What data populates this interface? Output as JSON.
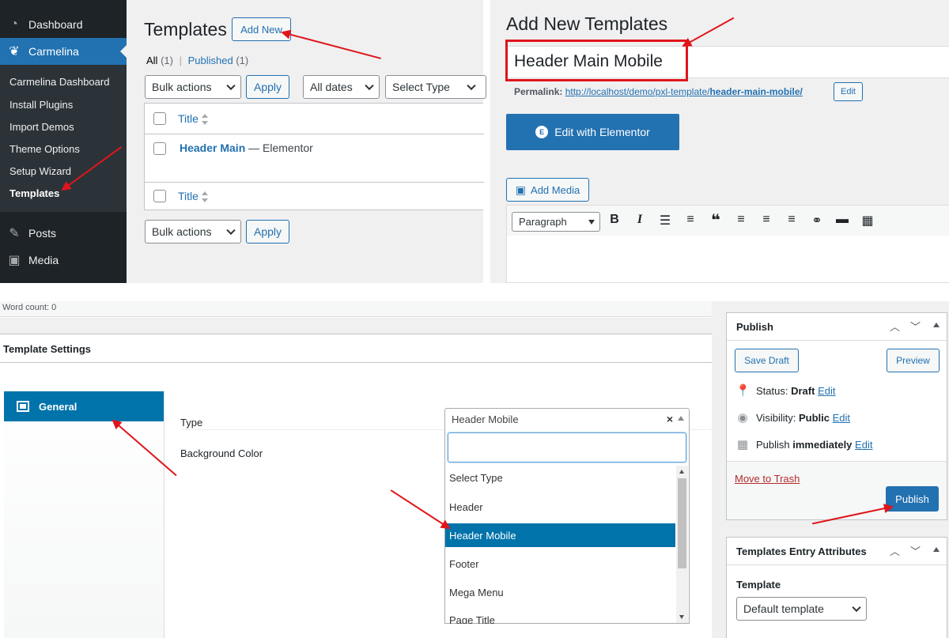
{
  "sidebar": {
    "dashboard": "Dashboard",
    "carmelina": "Carmelina",
    "submenu": [
      "Carmelina Dashboard",
      "Install Plugins",
      "Import Demos",
      "Theme Options",
      "Setup Wizard",
      "Templates"
    ],
    "posts": "Posts",
    "media": "Media"
  },
  "templates_list": {
    "page_title": "Templates",
    "add_new": "Add New",
    "filter_all": "All",
    "filter_all_count": "(1)",
    "separator": "|",
    "filter_published": "Published",
    "filter_published_count": "(1)",
    "bulk_actions": "Bulk actions",
    "apply": "Apply",
    "all_dates": "All dates",
    "select_type": "Select Type",
    "col_title": "Title",
    "row_title": "Header Main",
    "row_suffix": "— Elementor"
  },
  "editor": {
    "heading": "Add New Templates",
    "title_value": "Header Main Mobile",
    "permalink_label": "Permalink:",
    "permalink_url": "http://localhost/demo/pxl-template/",
    "permalink_slug": "header-main-mobile/",
    "edit": "Edit",
    "elementor_button": "Edit with Elementor",
    "add_media": "Add Media",
    "paragraph": "Paragraph"
  },
  "word_count": "Word count: 0",
  "template_settings": {
    "title": "Template Settings",
    "tab_general": "General",
    "type_label": "Type",
    "bg_label": "Background Color",
    "type_selected": "Header Mobile",
    "clear_icon": "×",
    "options": [
      "Select Type",
      "Header",
      "Header Mobile",
      "Footer",
      "Mega Menu",
      "Page Title"
    ]
  },
  "publish_box": {
    "title": "Publish",
    "save_draft": "Save Draft",
    "preview": "Preview",
    "status_label": "Status:",
    "status_value": "Draft",
    "visibility_label": "Visibility:",
    "visibility_value": "Public",
    "publish_label": "Publish",
    "publish_value": "immediately",
    "edit": "Edit",
    "trash": "Move to Trash",
    "publish_button": "Publish"
  },
  "attributes_box": {
    "title": "Templates Entry Attributes",
    "template_label": "Template",
    "template_value": "Default template"
  },
  "colors": {
    "accent": "#2271b1",
    "admin_bar": "#1d2327",
    "highlight": "#0073aa",
    "arrow_red": "#e0151b"
  }
}
